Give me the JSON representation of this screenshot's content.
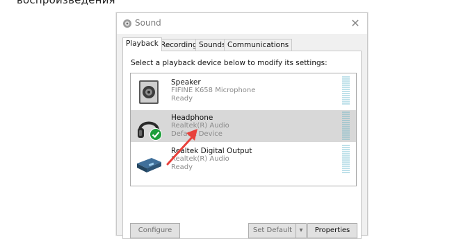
{
  "page": {
    "heading_fragment": "воспроизведения"
  },
  "window": {
    "title": "Sound",
    "close_glyph": "✕"
  },
  "tabs": [
    {
      "label": "Playback",
      "active": true
    },
    {
      "label": "Recording",
      "active": false
    },
    {
      "label": "Sounds",
      "active": false
    },
    {
      "label": "Communications",
      "active": false
    }
  ],
  "playback": {
    "instruction": "Select a playback device below to modify its settings:",
    "devices": [
      {
        "name": "Speaker",
        "description": "FIFINE K658 Microphone",
        "status": "Ready",
        "icon": "speaker-icon",
        "selected": false
      },
      {
        "name": "Headphone",
        "description": "Realtek(R) Audio",
        "status": "Default Device",
        "icon": "headphone-icon",
        "selected": true
      },
      {
        "name": "Realtek Digital Output",
        "description": "Realtek(R) Audio",
        "status": "Ready",
        "icon": "digital-output-icon",
        "selected": false
      }
    ]
  },
  "buttons": {
    "configure": "Configure",
    "set_default": "Set Default",
    "properties": "Properties"
  },
  "colors": {
    "selection": "#d8d8d8",
    "arrow": "#e8413b",
    "default_check": "#1e9e3b"
  }
}
